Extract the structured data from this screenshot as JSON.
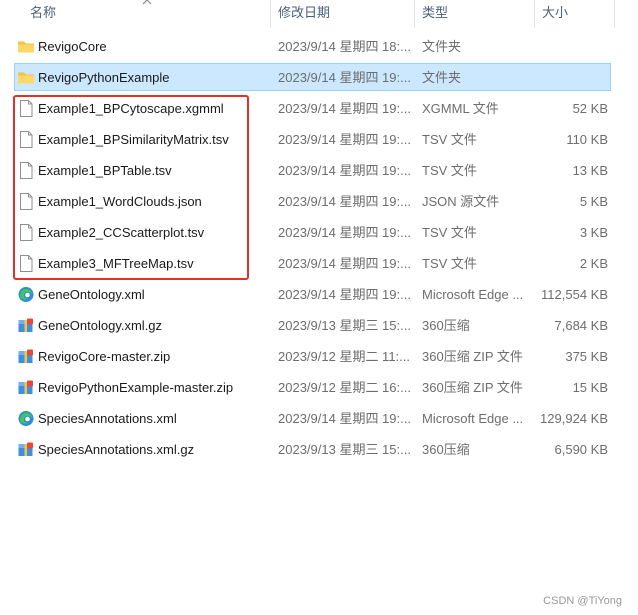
{
  "columns": {
    "name": "名称",
    "date": "修改日期",
    "type": "类型",
    "size": "大小"
  },
  "rows": [
    {
      "icon": "folder-icon",
      "name": "RevigoCore",
      "date": "2023/9/14 星期四 18:...",
      "type": "文件夹",
      "size": ""
    },
    {
      "icon": "folder-icon",
      "name": "RevigoPythonExample",
      "date": "2023/9/14 星期四 19:...",
      "type": "文件夹",
      "size": "",
      "selected": true
    },
    {
      "icon": "file-icon",
      "name": "Example1_BPCytoscape.xgmml",
      "date": "2023/9/14 星期四 19:...",
      "type": "XGMML 文件",
      "size": "52 KB"
    },
    {
      "icon": "file-icon",
      "name": "Example1_BPSimilarityMatrix.tsv",
      "date": "2023/9/14 星期四 19:...",
      "type": "TSV 文件",
      "size": "110 KB"
    },
    {
      "icon": "file-icon",
      "name": "Example1_BPTable.tsv",
      "date": "2023/9/14 星期四 19:...",
      "type": "TSV 文件",
      "size": "13 KB"
    },
    {
      "icon": "file-icon",
      "name": "Example1_WordClouds.json",
      "date": "2023/9/14 星期四 19:...",
      "type": "JSON 源文件",
      "size": "5 KB"
    },
    {
      "icon": "file-icon",
      "name": "Example2_CCScatterplot.tsv",
      "date": "2023/9/14 星期四 19:...",
      "type": "TSV 文件",
      "size": "3 KB"
    },
    {
      "icon": "file-icon",
      "name": "Example3_MFTreeMap.tsv",
      "date": "2023/9/14 星期四 19:...",
      "type": "TSV 文件",
      "size": "2 KB"
    },
    {
      "icon": "edge-icon",
      "name": "GeneOntology.xml",
      "date": "2023/9/14 星期四 19:...",
      "type": "Microsoft Edge ...",
      "size": "112,554 KB"
    },
    {
      "icon": "archive-icon",
      "name": "GeneOntology.xml.gz",
      "date": "2023/9/13 星期三 15:...",
      "type": "360压缩",
      "size": "7,684 KB"
    },
    {
      "icon": "archive-icon",
      "name": "RevigoCore-master.zip",
      "date": "2023/9/12 星期二 11:...",
      "type": "360压缩 ZIP 文件",
      "size": "375 KB"
    },
    {
      "icon": "archive-icon",
      "name": "RevigoPythonExample-master.zip",
      "date": "2023/9/12 星期二 16:...",
      "type": "360压缩 ZIP 文件",
      "size": "15 KB"
    },
    {
      "icon": "edge-icon",
      "name": "SpeciesAnnotations.xml",
      "date": "2023/9/14 星期四 19:...",
      "type": "Microsoft Edge ...",
      "size": "129,924 KB"
    },
    {
      "icon": "archive-icon",
      "name": "SpeciesAnnotations.xml.gz",
      "date": "2023/9/13 星期三 15:...",
      "type": "360压缩",
      "size": "6,590 KB"
    }
  ],
  "watermark": "CSDN @TiYong",
  "colors": {
    "selection": "#cce8ff",
    "highlight_border": "#e0302a",
    "folder": "#f5c242"
  }
}
